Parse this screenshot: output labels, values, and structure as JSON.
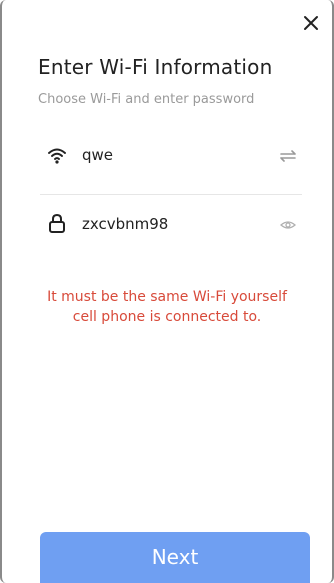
{
  "dialog": {
    "title": "Enter Wi-Fi Information",
    "subtitle": "Choose Wi-Fi and enter password"
  },
  "wifi": {
    "ssid": "qwe",
    "password": "zxcvbnm98",
    "icons": {
      "ssid_left": "wifi-icon",
      "ssid_right": "switch-arrows-icon",
      "password_left": "lock-icon",
      "password_right": "eye-icon"
    }
  },
  "warning": {
    "line1": "It must be the same Wi-Fi yourself",
    "line2": "cell phone is connected to."
  },
  "next_button": {
    "label": "Next"
  },
  "colors": {
    "primary": "#6f9ff2",
    "warning": "#d84a3a",
    "subtitle": "#9a9a9a"
  }
}
